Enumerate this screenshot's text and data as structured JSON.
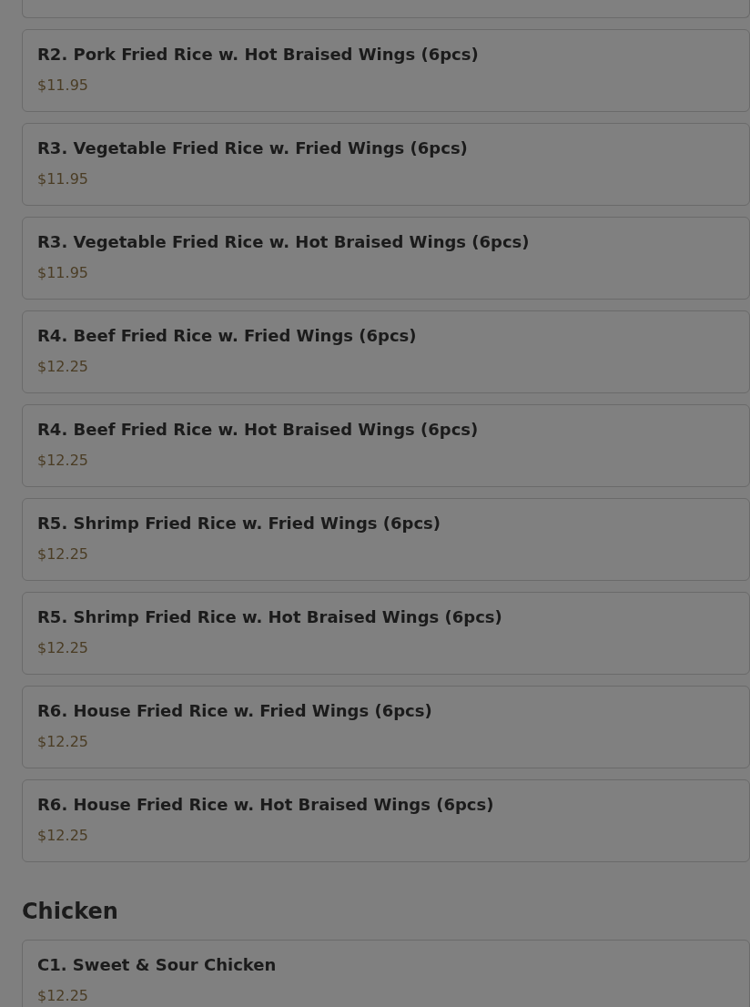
{
  "sections": [
    {
      "items": [
        {
          "name": "R2. Pork Fried Rice w. Hot Braised Wings (6pcs)",
          "price": "$11.95"
        },
        {
          "name": "R3. Vegetable Fried Rice w. Fried Wings (6pcs)",
          "price": "$11.95"
        },
        {
          "name": "R3. Vegetable Fried Rice w. Hot Braised Wings (6pcs)",
          "price": "$11.95"
        },
        {
          "name": "R4. Beef Fried Rice w. Fried Wings (6pcs)",
          "price": "$12.25"
        },
        {
          "name": "R4. Beef Fried Rice w. Hot Braised Wings (6pcs)",
          "price": "$12.25"
        },
        {
          "name": "R5. Shrimp Fried Rice w. Fried Wings (6pcs)",
          "price": "$12.25"
        },
        {
          "name": "R5. Shrimp Fried Rice w. Hot Braised Wings (6pcs)",
          "price": "$12.25"
        },
        {
          "name": "R6. House Fried Rice w. Fried Wings (6pcs)",
          "price": "$12.25"
        },
        {
          "name": "R6. House Fried Rice w. Hot Braised Wings (6pcs)",
          "price": "$12.25"
        }
      ]
    },
    {
      "heading": "Chicken",
      "items": [
        {
          "name": "C1. Sweet & Sour Chicken",
          "price": "$12.25"
        }
      ]
    }
  ]
}
